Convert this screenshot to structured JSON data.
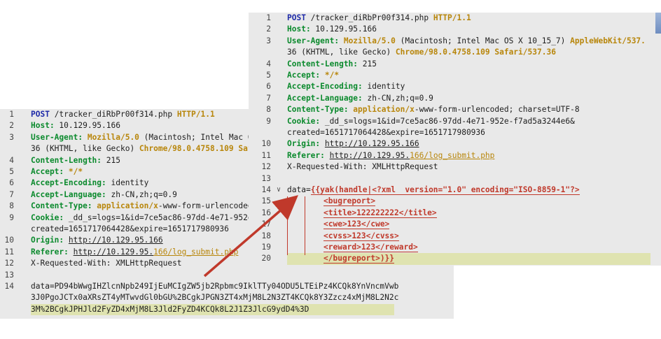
{
  "request_back": {
    "lines": [
      {
        "n": "1",
        "request_line": {
          "method": "POST",
          "path": " /tracker_diRbPr00f314.php ",
          "version": "HTTP/1.1"
        }
      },
      {
        "n": "2",
        "header": "Host:",
        "value": " 10.129.95.166"
      },
      {
        "n": "3",
        "header": "User-Agent:",
        "value_gold": " Mozilla/5.0",
        "value": " (Macintosh; Intel Mac O"
      },
      {
        "n": "",
        "cont": "36 (KHTML, like Gecko) ",
        "cont_gold": "Chrome/98.0.4758.109 Saf"
      },
      {
        "n": "4",
        "header": "Content-Length:",
        "value": " 215"
      },
      {
        "n": "5",
        "header": "Accept:",
        "value_gold": " */*"
      },
      {
        "n": "6",
        "header": "Accept-Encoding:",
        "value": " identity"
      },
      {
        "n": "7",
        "header": "Accept-Language:",
        "value": " zh-CN,zh;q=0.9"
      },
      {
        "n": "8",
        "header": "Content-Type:",
        "value_gold": " application/x",
        "value": "-www-form-urlencoded"
      },
      {
        "n": "9",
        "header": "Cookie:",
        "value": " _dd_s=logs=1&id=7ce5ac86-97dd-4e71-952e"
      },
      {
        "n": "",
        "cont": "created=1651717064428&expire=1651717980936"
      },
      {
        "n": "10",
        "header": "Origin:",
        "link": "http://10.129.95.166"
      },
      {
        "n": "11",
        "header": "Referer:",
        "link": "http://10.129.95.",
        "link_gold": "166/log_submit.php"
      },
      {
        "n": "12",
        "plain": "X-Requested-With: XMLHttpRequest"
      },
      {
        "n": "13",
        "plain": ""
      },
      {
        "n": "14",
        "plain": "data=PD94bWwgIHZlcnNpb249IjEuMCIgZW5jb2Rpbmc9IklTTy04ODU5LTEiPz4KCQk8YnVncmVwb"
      },
      {
        "n": "",
        "plain": "3J0PgoJCTx0aXRsZT4yMTwvdGl0bGU%2BCgkJPGN3ZT4xMjM8L2N3ZT4KCQk8Y3Zzcz4xMjM8L2N2c"
      },
      {
        "n": "",
        "plain": "3M%2BCgkJPHJld2FyZD4xMjM8L3Jld2FyZD4KCQk8L2J1Z3JlcG9ydD4%3D"
      }
    ]
  },
  "request_front": {
    "lines": [
      {
        "n": "1",
        "request_line": {
          "method": "POST",
          "path": " /tracker_diRbPr00f314.php ",
          "version": "HTTP/1.1"
        }
      },
      {
        "n": "2",
        "header": "Host:",
        "value": " 10.129.95.166"
      },
      {
        "n": "3",
        "header": "User-Agent:",
        "value_gold": " Mozilla/5.0",
        "value": " (Macintosh; Intel Mac OS X 10_15_7) ",
        "value_gold2": "AppleWebKit/537."
      },
      {
        "n": "",
        "cont": "36 (KHTML, like Gecko) ",
        "cont_gold": "Chrome/98.0.4758.109 Safari/537.36"
      },
      {
        "n": "4",
        "header": "Content-Length:",
        "value": " 215"
      },
      {
        "n": "5",
        "header": "Accept:",
        "value_gold": " */*"
      },
      {
        "n": "6",
        "header": "Accept-Encoding:",
        "value": " identity"
      },
      {
        "n": "7",
        "header": "Accept-Language:",
        "value": " zh-CN,zh;q=0.9"
      },
      {
        "n": "8",
        "header": "Content-Type:",
        "value_gold": " application/x",
        "value": "-www-form-urlencoded; charset=UTF-8"
      },
      {
        "n": "9",
        "header": "Cookie:",
        "value": " _dd_s=logs=1&id=7ce5ac86-97dd-4e71-952e-f7ad5a3244e6&"
      },
      {
        "n": "",
        "cont": "created=1651717064428&expire=1651717980936"
      },
      {
        "n": "10",
        "header": "Origin:",
        "link": "http://10.129.95.166"
      },
      {
        "n": "11",
        "header": "Referer:",
        "link": "http://10.129.95.",
        "link_gold": "166/log_submit.php"
      },
      {
        "n": "12",
        "plain": "X-Requested-With: XMLHttpRequest"
      },
      {
        "n": "13",
        "plain": ""
      },
      {
        "n": "14",
        "data_prefix": "data=",
        "xml": "{{yak(handle|<?xml  version=\"1.0\" encoding=\"ISO-8859-1\"?>"
      },
      {
        "n": "15",
        "xml_indent": "<bugreport>"
      },
      {
        "n": "16",
        "xml_indent": "<title>122222222</title>"
      },
      {
        "n": "17",
        "xml_indent": "<cwe>123</cwe>"
      },
      {
        "n": "18",
        "xml_indent": "<cvss>123</cvss>"
      },
      {
        "n": "19",
        "xml_indent": "<reward>123</reward>"
      },
      {
        "n": "20",
        "xml_indent": "</bugreport>)}}"
      }
    ]
  },
  "colors": {
    "keyword": "#1e2aa8",
    "header_name": "#0b8a2d",
    "header_value_highlight": "#b8860b",
    "injected_xml": "#c0392b",
    "arrow": "#c0392b",
    "current_line": "#dfe3b0",
    "panel_bg": "#e9e9e9"
  },
  "icons": {
    "fold": "chevron-down-icon"
  }
}
